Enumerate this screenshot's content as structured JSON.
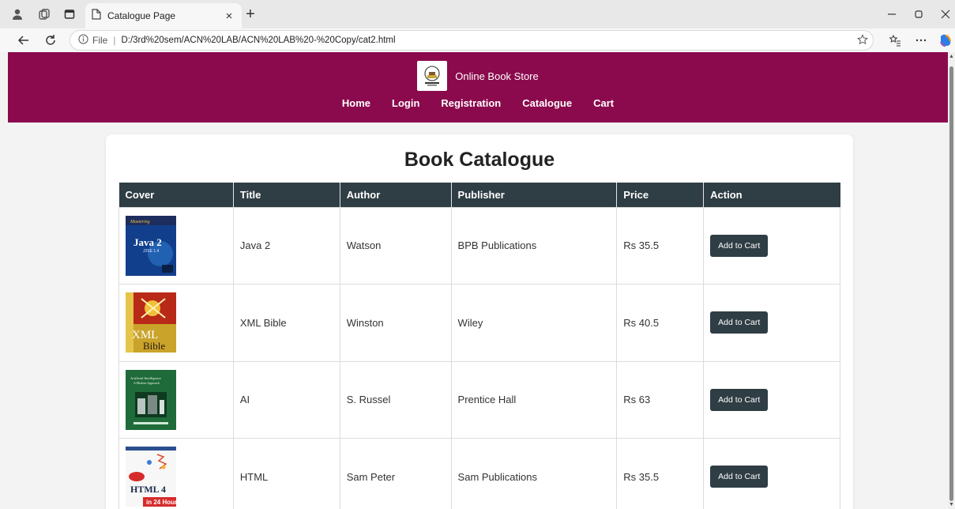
{
  "browser": {
    "tab_title": "Catalogue Page",
    "tab_close": "×",
    "new_tab": "+",
    "url_prefix": "File",
    "url_separator": "|",
    "url": "D:/3rd%20sem/ACN%20LAB/ACN%20LAB%20-%20Copy/cat2.html"
  },
  "site": {
    "brand_name": "Online Book Store",
    "nav": [
      "Home",
      "Login",
      "Registration",
      "Catalogue",
      "Cart"
    ]
  },
  "catalogue": {
    "title": "Book Catalogue",
    "columns": [
      "Cover",
      "Title",
      "Author",
      "Publisher",
      "Price",
      "Action"
    ],
    "button_label": "Add to Cart",
    "rows": [
      {
        "cover_text": [
          "Mastering",
          "Java 2",
          "J2SE 1.4"
        ],
        "title": "Java 2",
        "author": "Watson",
        "publisher": "BPB Publications",
        "price": "Rs 35.5"
      },
      {
        "cover_text": [
          "XML",
          "Bible"
        ],
        "title": "XML Bible",
        "author": "Winston",
        "publisher": "Wiley",
        "price": "Rs 40.5"
      },
      {
        "cover_text": [
          "Artificial Intelligence",
          "A Modern Approach"
        ],
        "title": "AI",
        "author": "S. Russel",
        "publisher": "Prentice Hall",
        "price": "Rs 63"
      },
      {
        "cover_text": [
          "HTML 4",
          "in 24 Hours"
        ],
        "title": "HTML",
        "author": "Sam Peter",
        "publisher": "Sam Publications",
        "price": "Rs 35.5"
      }
    ]
  },
  "colors": {
    "header": "#8b0a4d",
    "table_head": "#2f3d44",
    "button": "#2f3d44"
  }
}
